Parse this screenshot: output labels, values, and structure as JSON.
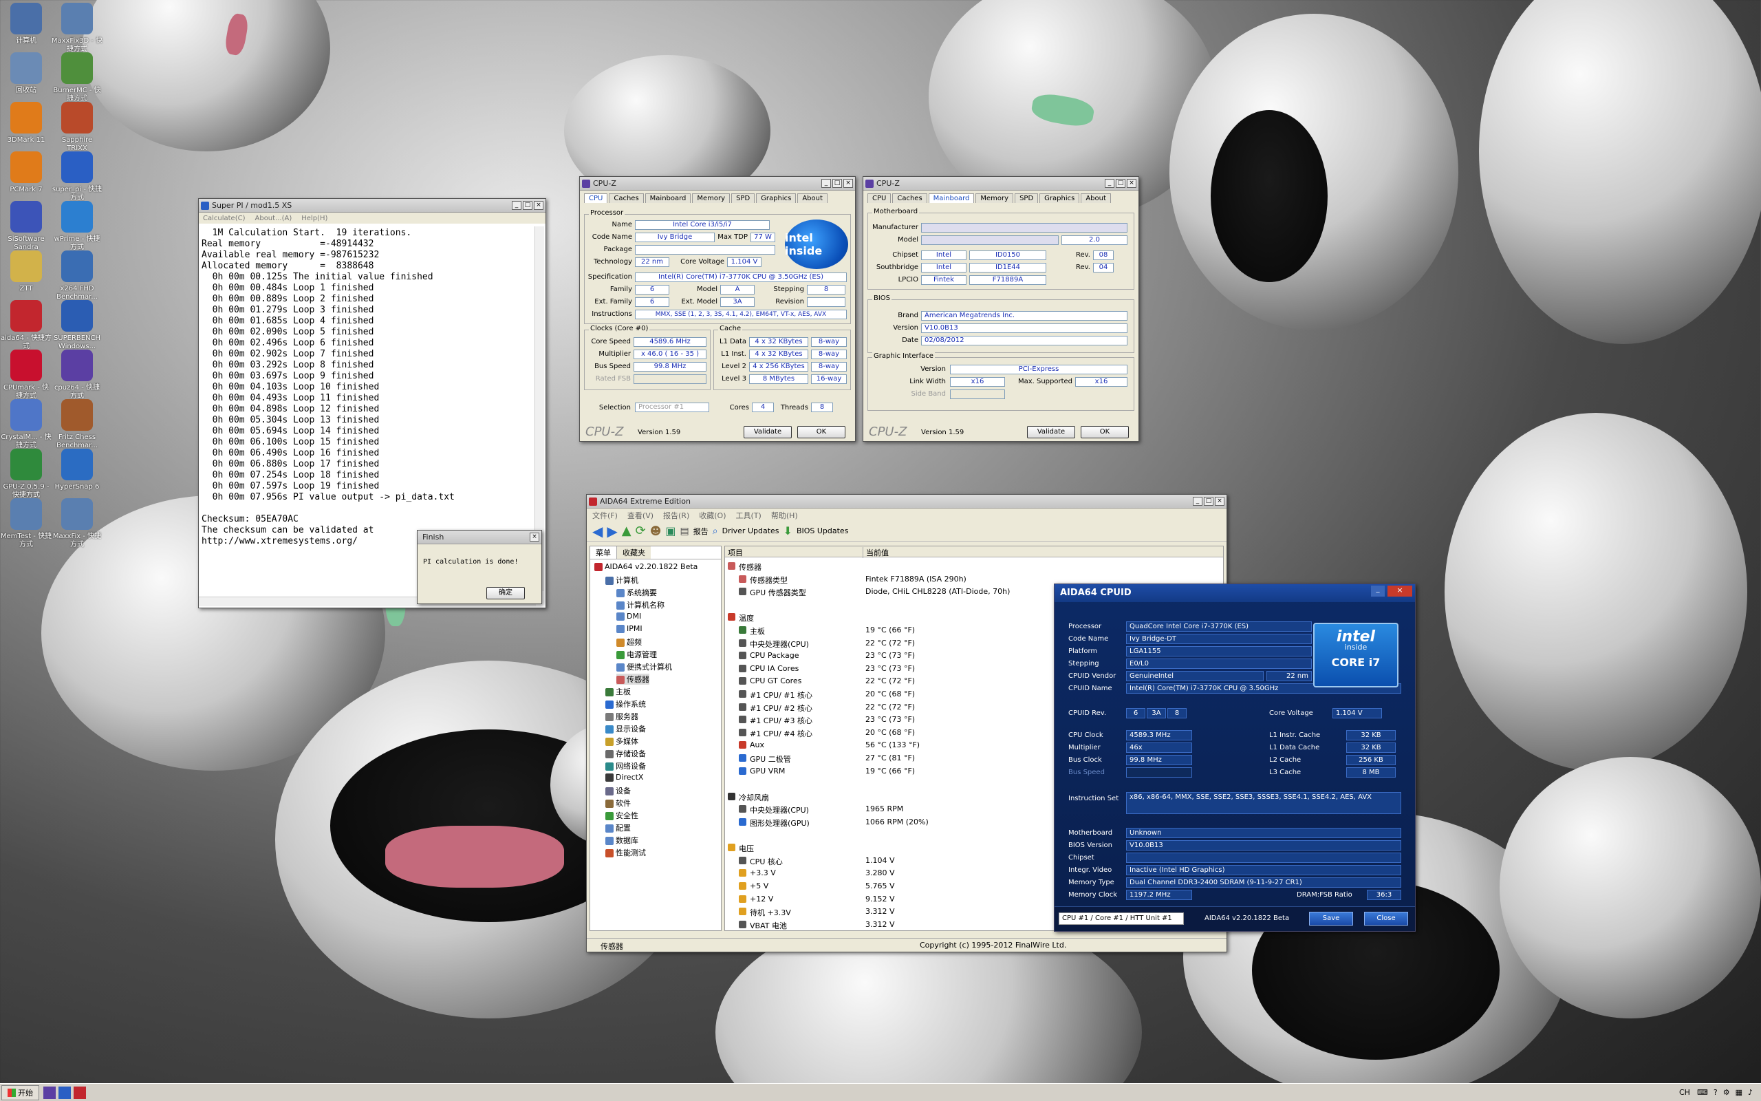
{
  "desktop": {
    "icons": [
      {
        "label": "计算机",
        "color": "#4a6fa8"
      },
      {
        "label": "MaxxFix3D - 快捷方式",
        "color": "#5a7fb0"
      },
      {
        "label": "回收站",
        "color": "#6b8bb5"
      },
      {
        "label": "BurnerMC - 快捷方式",
        "color": "#4f8f3c"
      },
      {
        "label": "3DMark 11",
        "color": "#e07b1a"
      },
      {
        "label": "Sapphire TRIXX",
        "color": "#b94a2a"
      },
      {
        "label": "PCMark 7",
        "color": "#e07b1a"
      },
      {
        "label": "super_pi - 快捷方式",
        "color": "#2a5fc4"
      },
      {
        "label": "SiSoftware Sandra",
        "color": "#3c54b8"
      },
      {
        "label": "wPrime - 快捷方式",
        "color": "#2c7fd0"
      },
      {
        "label": "ZTT",
        "color": "#d2b24a"
      },
      {
        "label": "x264 FHD Benchmar...",
        "color": "#3a6db3"
      },
      {
        "label": "aida64 - 快捷方式",
        "color": "#c2262e"
      },
      {
        "label": "SUPERBENCH Windows...",
        "color": "#2b5db3"
      },
      {
        "label": "CPUmark - 快捷方式",
        "color": "#c8102e"
      },
      {
        "label": "cpuz64 - 快捷方式",
        "color": "#5b3fa3"
      },
      {
        "label": "CrystalM... - 快捷方式",
        "color": "#4f76c8"
      },
      {
        "label": "Fritz Chess Benchmar...",
        "color": "#a05a2c"
      },
      {
        "label": "GPU-Z 0.5.9 - 快捷方式",
        "color": "#2f8a3c"
      },
      {
        "label": "HyperSnap 6",
        "color": "#2b6cc2"
      },
      {
        "label": "MemTest - 快捷方式",
        "color": "#5a7fb0"
      },
      {
        "label": "MaxxFix - 快捷方式",
        "color": "#5a7fb0"
      }
    ]
  },
  "superpi": {
    "title": "Super PI / mod1.5 XS",
    "menu": [
      "Calculate(C)",
      "About...(A)",
      "Help(H)"
    ],
    "lines": [
      "  1M Calculation Start.  19 iterations.",
      "Real memory           =-48914432",
      "Available real memory =-987615232",
      "Allocated memory      =  8388648",
      "  0h 00m 00.125s The initial value finished",
      "  0h 00m 00.484s Loop 1 finished",
      "  0h 00m 00.889s Loop 2 finished",
      "  0h 00m 01.279s Loop 3 finished",
      "  0h 00m 01.685s Loop 4 finished",
      "  0h 00m 02.090s Loop 5 finished",
      "  0h 00m 02.496s Loop 6 finished",
      "  0h 00m 02.902s Loop 7 finished",
      "  0h 00m 03.292s Loop 8 finished",
      "  0h 00m 03.697s Loop 9 finished",
      "  0h 00m 04.103s Loop 10 finished",
      "  0h 00m 04.493s Loop 11 finished",
      "  0h 00m 04.898s Loop 12 finished",
      "  0h 00m 05.304s Loop 13 finished",
      "  0h 00m 05.694s Loop 14 finished",
      "  0h 00m 06.100s Loop 15 finished",
      "  0h 00m 06.490s Loop 16 finished",
      "  0h 00m 06.880s Loop 17 finished",
      "  0h 00m 07.254s Loop 18 finished",
      "  0h 00m 07.597s Loop 19 finished",
      "  0h 00m 07.956s PI value output -> pi_data.txt",
      "",
      "Checksum: 05EA70AC",
      "The checksum can be validated at",
      "http://www.xtremesystems.org/"
    ],
    "finish": {
      "title": "Finish",
      "message": "PI calculation is done!",
      "ok": "确定"
    }
  },
  "cpuz1": {
    "title": "CPU-Z",
    "tabs": [
      "CPU",
      "Caches",
      "Mainboard",
      "Memory",
      "SPD",
      "Graphics",
      "About"
    ],
    "processor_label": "Processor",
    "name_l": "Name",
    "name": "Intel Core i3/i5/i7",
    "codename_l": "Code Name",
    "codename": "Ivy Bridge",
    "maxtdp_l": "Max TDP",
    "maxtdp": "77 W",
    "package_l": "Package",
    "package": "",
    "technology_l": "Technology",
    "technology": "22 nm",
    "corevoltage_l": "Core Voltage",
    "corevoltage": "1.104 V",
    "spec_l": "Specification",
    "spec": "Intel(R) Core(TM) i7-3770K CPU @ 3.50GHz (ES)",
    "family_l": "Family",
    "family": "6",
    "model_l": "Model",
    "model": "A",
    "stepping_l": "Stepping",
    "stepping": "8",
    "extfamily_l": "Ext. Family",
    "extfamily": "6",
    "extmodel_l": "Ext. Model",
    "extmodel": "3A",
    "revision_l": "Revision",
    "revision": "",
    "instructions_l": "Instructions",
    "instructions": "MMX, SSE (1, 2, 3, 3S, 4.1, 4.2), EM64T, VT-x, AES, AVX",
    "clocks_label": "Clocks (Core #0)",
    "cache_label": "Cache",
    "corespeed_l": "Core Speed",
    "corespeed": "4589.6 MHz",
    "multiplier_l": "Multiplier",
    "multiplier": "x 46.0 ( 16 - 35 )",
    "busspeed_l": "Bus Speed",
    "busspeed": "99.8 MHz",
    "ratedfsb_l": "Rated FSB",
    "ratedfsb": "",
    "l1d_l": "L1 Data",
    "l1d": "4 x 32 KBytes",
    "l1d_w": "8-way",
    "l1i_l": "L1 Inst.",
    "l1i": "4 x 32 KBytes",
    "l1i_w": "8-way",
    "l2_l": "Level 2",
    "l2": "4 x 256 KBytes",
    "l2_w": "8-way",
    "l3_l": "Level 3",
    "l3": "8 MBytes",
    "l3_w": "16-way",
    "selection_l": "Selection",
    "selection": "Processor #1",
    "cores_l": "Cores",
    "cores": "4",
    "threads_l": "Threads",
    "threads": "8",
    "brand": "CPU-Z",
    "version": "Version 1.59",
    "validate": "Validate",
    "ok": "OK",
    "intel_logo": "intel inside"
  },
  "cpuz2": {
    "title": "CPU-Z",
    "tabs": [
      "CPU",
      "Caches",
      "Mainboard",
      "Memory",
      "SPD",
      "Graphics",
      "About"
    ],
    "motherboard_label": "Motherboard",
    "manufacturer_l": "Manufacturer",
    "manufacturer": "",
    "model_l": "Model",
    "model": "",
    "model_rev": "2.0",
    "chipset_l": "Chipset",
    "chipset": "Intel",
    "chipset_id": "ID0150",
    "rev_l": "Rev.",
    "chipset_rev": "08",
    "southbridge_l": "Southbridge",
    "southbridge": "Intel",
    "southbridge_id": "ID1E44",
    "southbridge_rev": "04",
    "lpcio_l": "LPCIO",
    "lpcio": "Fintek",
    "lpcio_id": "F71889A",
    "bios_label": "BIOS",
    "brand_l": "Brand",
    "bios_brand": "American Megatrends Inc.",
    "version_l": "Version",
    "bios_version": "V10.0B13",
    "date_l": "Date",
    "bios_date": "02/08/2012",
    "gi_label": "Graphic Interface",
    "gi_version_l": "Version",
    "gi_version": "PCI-Express",
    "linkwidth_l": "Link Width",
    "linkwidth": "x16",
    "maxsup_l": "Max. Supported",
    "maxsup": "x16",
    "sideband_l": "Side Band",
    "sideband": "",
    "brand": "CPU-Z",
    "version": "Version 1.59",
    "validate": "Validate",
    "ok": "OK"
  },
  "aida": {
    "title": "AIDA64 Extreme Edition",
    "menu": [
      "文件(F)",
      "查看(V)",
      "报告(R)",
      "收藏(O)",
      "工具(T)",
      "帮助(H)"
    ],
    "toolbar": {
      "report": "报告",
      "driver": "Driver Updates",
      "bios": "BIOS Updates"
    },
    "tabs": [
      "菜单",
      "收藏夹"
    ],
    "tree": [
      {
        "label": "AIDA64 v2.20.1822 Beta",
        "indent": 0,
        "color": "#c2262e"
      },
      {
        "label": "计算机",
        "indent": 1,
        "color": "#4a6fa8"
      },
      {
        "label": "系统摘要",
        "indent": 2,
        "color": "#5a86c8"
      },
      {
        "label": "计算机名称",
        "indent": 2,
        "color": "#5a86c8"
      },
      {
        "label": "DMI",
        "indent": 2,
        "color": "#5a86c8"
      },
      {
        "label": "IPMI",
        "indent": 2,
        "color": "#5a86c8"
      },
      {
        "label": "超频",
        "indent": 2,
        "color": "#d08a2a"
      },
      {
        "label": "电源管理",
        "indent": 2,
        "color": "#3a9a3a"
      },
      {
        "label": "便携式计算机",
        "indent": 2,
        "color": "#5a86c8"
      },
      {
        "label": "传感器",
        "indent": 2,
        "color": "#c85a5a"
      },
      {
        "label": "主板",
        "indent": 1,
        "color": "#3a7a3a"
      },
      {
        "label": "操作系统",
        "indent": 1,
        "color": "#2a6ad0"
      },
      {
        "label": "服务器",
        "indent": 1,
        "color": "#7a7a7a"
      },
      {
        "label": "显示设备",
        "indent": 1,
        "color": "#3a8ac8"
      },
      {
        "label": "多媒体",
        "indent": 1,
        "color": "#c8a02a"
      },
      {
        "label": "存储设备",
        "indent": 1,
        "color": "#6a6a6a"
      },
      {
        "label": "网络设备",
        "indent": 1,
        "color": "#2a8a8a"
      },
      {
        "label": "DirectX",
        "indent": 1,
        "color": "#3a3a3a"
      },
      {
        "label": "设备",
        "indent": 1,
        "color": "#6a6a8a"
      },
      {
        "label": "软件",
        "indent": 1,
        "color": "#8a6a3a"
      },
      {
        "label": "安全性",
        "indent": 1,
        "color": "#3a9a3a"
      },
      {
        "label": "配置",
        "indent": 1,
        "color": "#5a86c8"
      },
      {
        "label": "数据库",
        "indent": 1,
        "color": "#5a86c8"
      },
      {
        "label": "性能测试",
        "indent": 1,
        "color": "#c8502a"
      }
    ],
    "col_item": "项目",
    "col_value": "当前值",
    "rows": [
      {
        "type": "header",
        "label": "传感器",
        "icon": "sensor"
      },
      {
        "label": "传感器类型",
        "value": "Fintek F71889A  (ISA 290h)",
        "icon": "sensor"
      },
      {
        "label": "GPU 传感器类型",
        "value": "Diode, CHiL CHL8228  (ATI-Diode, 70h)",
        "icon": "chip"
      },
      {
        "type": "blank"
      },
      {
        "type": "header",
        "label": "温度",
        "icon": "temp"
      },
      {
        "label": "主板",
        "value": "19 °C  (66 °F)",
        "icon": "board"
      },
      {
        "label": "中央处理器(CPU)",
        "value": "22 °C  (72 °F)",
        "icon": "chip"
      },
      {
        "label": "CPU Package",
        "value": "23 °C  (73 °F)",
        "icon": "chip"
      },
      {
        "label": "CPU IA Cores",
        "value": "23 °C  (73 °F)",
        "icon": "chip"
      },
      {
        "label": "CPU GT Cores",
        "value": "22 °C  (72 °F)",
        "icon": "chip"
      },
      {
        "label": "#1 CPU/ #1 核心",
        "value": "20 °C  (68 °F)",
        "icon": "chip"
      },
      {
        "label": "#1 CPU/ #2 核心",
        "value": "22 °C  (72 °F)",
        "icon": "chip"
      },
      {
        "label": "#1 CPU/ #3 核心",
        "value": "23 °C  (73 °F)",
        "icon": "chip"
      },
      {
        "label": "#1 CPU/ #4 核心",
        "value": "20 °C  (68 °F)",
        "icon": "chip"
      },
      {
        "label": "Aux",
        "value": "56 °C  (133 °F)",
        "icon": "temp"
      },
      {
        "label": "GPU 二极管",
        "value": "27 °C  (81 °F)",
        "icon": "gpu"
      },
      {
        "label": "GPU VRM",
        "value": "19 °C  (66 °F)",
        "icon": "gpu"
      },
      {
        "type": "blank"
      },
      {
        "type": "header",
        "label": "冷却风扇",
        "icon": "fan"
      },
      {
        "label": "中央处理器(CPU)",
        "value": "1965 RPM",
        "icon": "chip"
      },
      {
        "label": "图形处理器(GPU)",
        "value": "1066 RPM  (20%)",
        "icon": "gpu"
      },
      {
        "type": "blank"
      },
      {
        "type": "header",
        "label": "电压",
        "icon": "warn"
      },
      {
        "label": "CPU 核心",
        "value": "1.104 V",
        "icon": "chip"
      },
      {
        "label": "+3.3 V",
        "value": "3.280 V",
        "icon": "warn"
      },
      {
        "label": "+5 V",
        "value": "5.765 V",
        "icon": "warn"
      },
      {
        "label": "+12 V",
        "value": "9.152 V",
        "icon": "warn"
      },
      {
        "label": "待机 +3.3V",
        "value": "3.312 V",
        "icon": "warn"
      },
      {
        "label": "VBAT 电池",
        "value": "3.312 V",
        "icon": "chip"
      }
    ],
    "status_left": "传感器",
    "status_right": "Copyright (c) 1995-2012 FinalWire Ltd."
  },
  "cpuid": {
    "title": "AIDA64 CPUID",
    "processor_l": "Processor",
    "processor": "QuadCore Intel Core i7-3770K (ES)",
    "codename_l": "Code Name",
    "codename": "Ivy Bridge-DT",
    "platform_l": "Platform",
    "platform": "LGA1155",
    "stepping_l": "Stepping",
    "stepping": "E0/L0",
    "vendor_l": "CPUID Vendor",
    "vendor": "GenuineIntel",
    "nm": "22 nm",
    "name_l": "CPUID Name",
    "name": "Intel(R) Core(TM) i7-3770K CPU @ 3.50GHz",
    "rev_l": "CPUID Rev.",
    "rev": [
      "6",
      "3A",
      "8"
    ],
    "corev_l": "Core Voltage",
    "corev": "1.104 V",
    "cpuclock_l": "CPU Clock",
    "cpuclock": "4589.3 MHz",
    "mult_l": "Multiplier",
    "mult": "46x",
    "busclock_l": "Bus Clock",
    "busclock": "99.8 MHz",
    "busspeed_l": "Bus Speed",
    "busspeed": "",
    "l1i_l": "L1 Instr. Cache",
    "l1i": "32 KB",
    "l1d_l": "L1 Data Cache",
    "l1d": "32 KB",
    "l2_l": "L2 Cache",
    "l2": "256 KB",
    "l3_l": "L3 Cache",
    "l3": "8 MB",
    "iset_l": "Instruction Set",
    "iset": "x86, x86-64, MMX, SSE, SSE2, SSE3, SSSE3, SSE4.1, SSE4.2, AES, AVX",
    "mb_l": "Motherboard",
    "mb": "Unknown",
    "bios_l": "BIOS Version",
    "bios": "V10.0B13",
    "chipset_l": "Chipset",
    "chipset": "",
    "video_l": "Integr. Video",
    "video": "Inactive  (Intel HD Graphics)",
    "memtype_l": "Memory Type",
    "memtype": "Dual Channel DDR3-2400 SDRAM  (9-11-9-27 CR1)",
    "memclock_l": "Memory Clock",
    "memclock": "1197.2 MHz",
    "dram_l": "DRAM:FSB Ratio",
    "dram": "36:3",
    "selector": "CPU #1 / Core #1 / HTT Unit #1",
    "footer": "AIDA64 v2.20.1822 Beta",
    "save": "Save",
    "close": "Close",
    "intel_top": "intel",
    "intel_inside": "inside",
    "intel_core": "CORE i7"
  },
  "taskbar": {
    "start": "开始",
    "tray": [
      "CH"
    ]
  }
}
